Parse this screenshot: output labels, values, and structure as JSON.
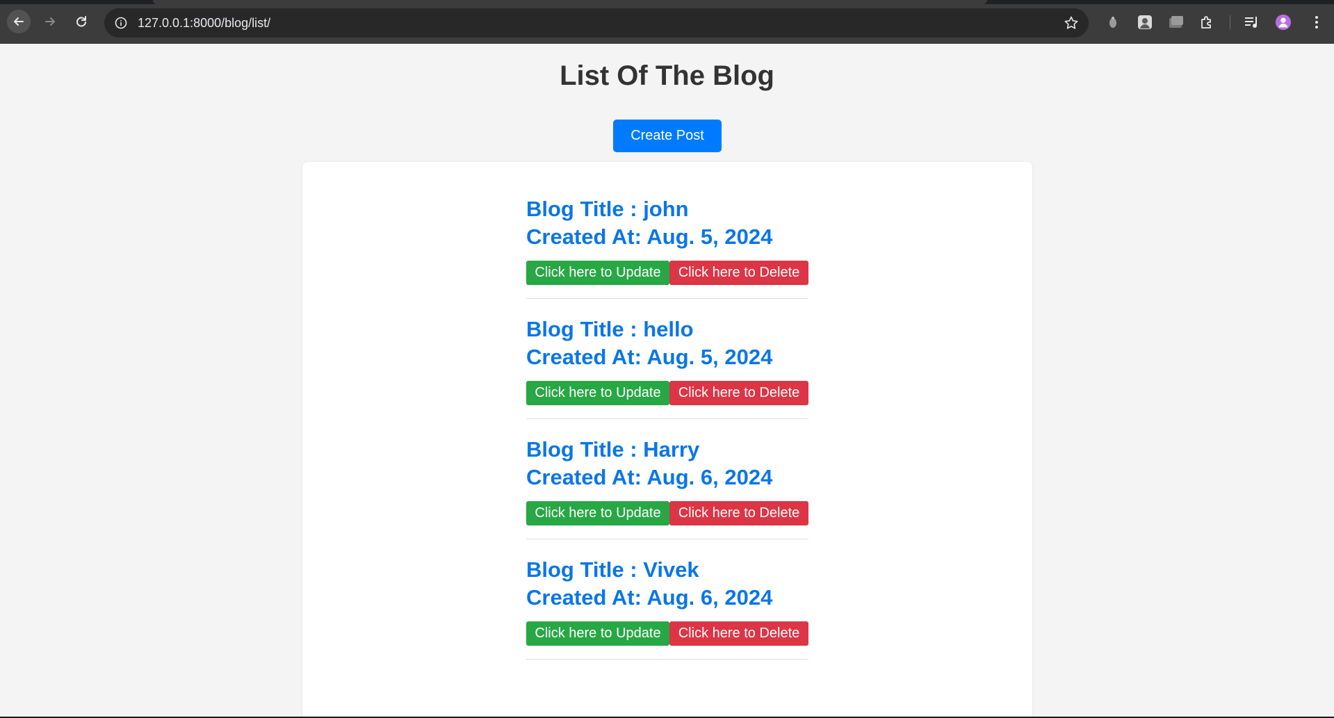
{
  "browser": {
    "url": "127.0.0.1:8000/blog/list/",
    "icons": [
      "back-arrow-icon",
      "forward-arrow-icon",
      "reload-icon",
      "info-icon",
      "star-icon",
      "extension-icon",
      "profile-avatar-icon",
      "menu-dots-icon"
    ]
  },
  "page": {
    "title": "List Of The Blog",
    "create_button": "Create Post"
  },
  "posts": [
    {
      "title": "Blog Title : john",
      "created": "Created At: Aug. 5, 2024",
      "update_label": "Click here to Update",
      "delete_label": "Click here to Delete"
    },
    {
      "title": "Blog Title : hello",
      "created": "Created At: Aug. 5, 2024",
      "update_label": "Click here to Update",
      "delete_label": "Click here to Delete"
    },
    {
      "title": "Blog Title : Harry",
      "created": "Created At: Aug. 6, 2024",
      "update_label": "Click here to Update",
      "delete_label": "Click here to Delete"
    },
    {
      "title": "Blog Title : Vivek",
      "created": "Created At: Aug. 6, 2024",
      "update_label": "Click here to Update",
      "delete_label": "Click here to Delete"
    }
  ],
  "colors": {
    "primary": "#007bff",
    "link_title": "#0a76e8",
    "update": "#28a745",
    "delete": "#dc3545",
    "heading": "#333333",
    "background": "#f4f4f4"
  }
}
